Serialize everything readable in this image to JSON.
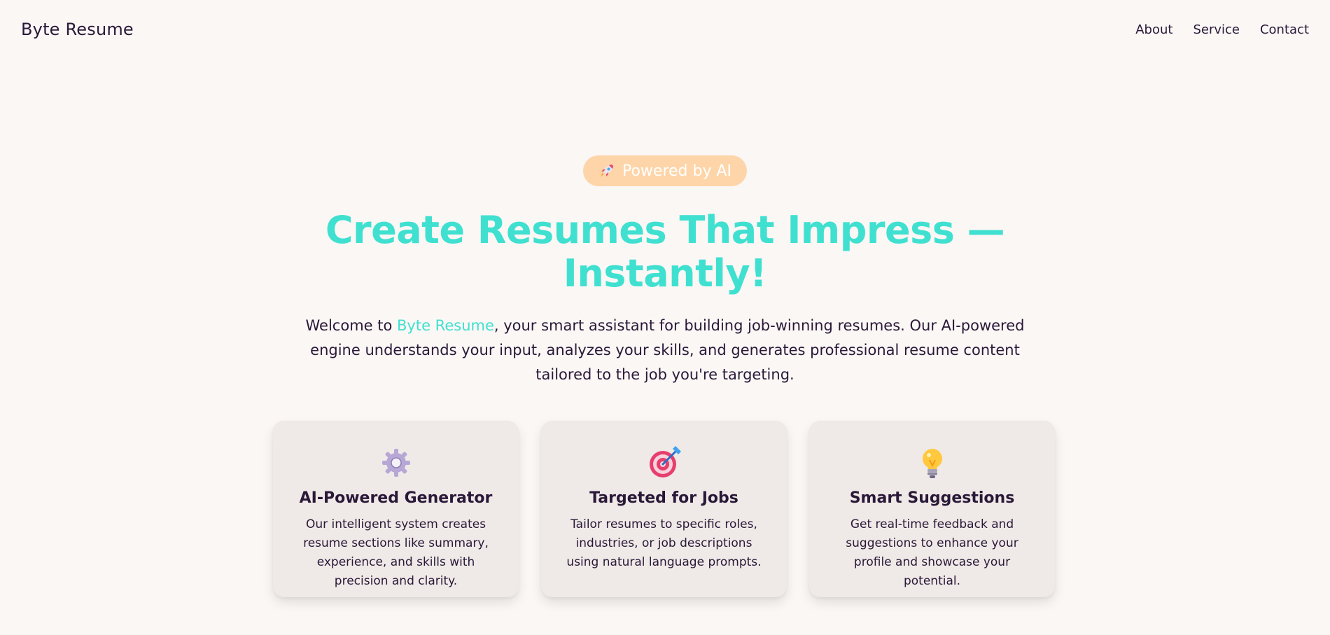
{
  "header": {
    "brand": "Byte Resume",
    "nav": [
      {
        "label": "About"
      },
      {
        "label": "Service"
      },
      {
        "label": "Contact"
      }
    ]
  },
  "hero": {
    "badge": {
      "icon": "rocket-icon",
      "label": "Powered by AI"
    },
    "title": "Create Resumes That Impress — Instantly!",
    "intro": {
      "prefix": "Welcome to ",
      "brand": "Byte Resume",
      "suffix": ", your smart assistant for building job-winning resumes. Our AI-powered engine understands your input, analyzes your skills, and generates professional resume content tailored to the job you're targeting."
    }
  },
  "features": [
    {
      "icon": "gear-icon",
      "title": "AI-Powered Generator",
      "text": "Our intelligent system creates resume sections like summary, experience, and skills with precision and clarity."
    },
    {
      "icon": "target-icon",
      "title": "Targeted for Jobs",
      "text": "Tailor resumes to specific roles, industries, or job descriptions using natural language prompts."
    },
    {
      "icon": "lightbulb-icon",
      "title": "Smart Suggestions",
      "text": "Get real-time feedback and suggestions to enhance your profile and showcase your potential."
    }
  ],
  "colors": {
    "background": "#faf7f5",
    "accent": "#40e0d0",
    "text": "#2a1838",
    "badge": "#fdd5a9",
    "card": "#efeae7"
  }
}
